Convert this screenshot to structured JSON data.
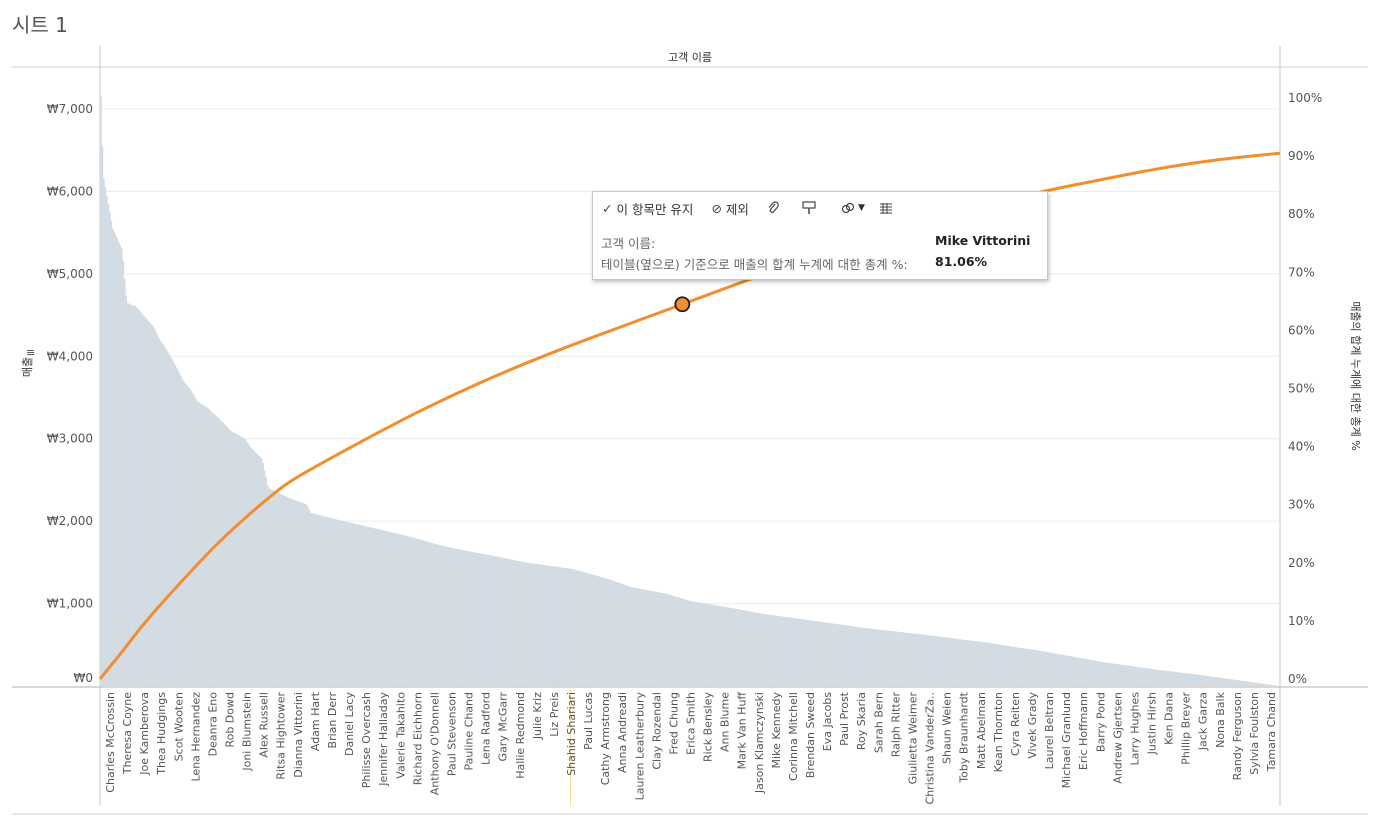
{
  "sheet": {
    "title": "시트 1"
  },
  "tooltip": {
    "keep_only": "이 항목만 유지",
    "exclude": "제외",
    "field1_label": "고객 이름:",
    "field1_value": "Mike Vittorini",
    "field2_label": "테이블(옆으로) 기준으로 매출의 합계 누계에 대한 총계 %:",
    "field2_value": "81.06%",
    "icons": [
      "check-icon",
      "exclude-icon",
      "paperclip-icon",
      "brush-icon",
      "group-icon",
      "chevron-down-icon",
      "table-view-icon"
    ]
  },
  "colors": {
    "bar": "#d3dbe3",
    "line": "#f28e2b",
    "highlight": "#f5e28a"
  },
  "chart_data": {
    "type": "bar",
    "title": "",
    "xlabel": "고객 이름",
    "ylabel": "매출",
    "y2label": "매출의 합계 누계에 대한 총계 %",
    "ylim": [
      0,
      7400
    ],
    "y2lim": [
      0,
      1.035
    ],
    "y_ticks": [
      "₩0",
      "₩1,000",
      "₩2,000",
      "₩3,000",
      "₩4,000",
      "₩5,000",
      "₩6,000",
      "₩7,000"
    ],
    "y_tick_values": [
      0,
      1000,
      2000,
      3000,
      4000,
      5000,
      6000,
      7000
    ],
    "y2_ticks": [
      "0%",
      "10%",
      "20%",
      "30%",
      "40%",
      "50%",
      "60%",
      "70%",
      "80%",
      "90%",
      "100%"
    ],
    "y2_tick_values": [
      0,
      0.1,
      0.2,
      0.3,
      0.4,
      0.5,
      0.6,
      0.7,
      0.8,
      0.9,
      1.0
    ],
    "categories": [
      "Charles McCrossin",
      "Theresa Coyne",
      "Joe Kamberova",
      "Thea Hudgings",
      "Scot Wooten",
      "Lena Hernandez",
      "Deanra Eno",
      "Rob Dowd",
      "Joni Blumstein",
      "Alex Russell",
      "Ritsa Hightower",
      "Dianna Vittorini",
      "Adam Hart",
      "Brian Derr",
      "Daniel Lacy",
      "Philisse Overcash",
      "Jennifer Halladay",
      "Valerie Takahito",
      "Richard Eichhorn",
      "Anthony O'Donnell",
      "Paul Stevenson",
      "Pauline Chand",
      "Lena Radford",
      "Gary McGarr",
      "Hallie Redmond",
      "Julie Kriz",
      "Liz Preis",
      "Shahid Shariari",
      "Paul Lucas",
      "Cathy Armstrong",
      "Anna Andreadi",
      "Lauren Leatherbury",
      "Clay Rozendal",
      "Fred Chung",
      "Erica Smith",
      "Rick Bensley",
      "Ann Blume",
      "Mark Van Huff",
      "Jason Klamczynski",
      "Mike Kennedy",
      "Corinna Mitchell",
      "Brendan Sweed",
      "Eva Jacobs",
      "Paul Prost",
      "Roy Skaria",
      "Sarah Bern",
      "Ralph Ritter",
      "Giulietta Weimer",
      "Christina VanderZa..",
      "Shaun Weien",
      "Toby Braunhardt",
      "Matt Abelman",
      "Kean Thornton",
      "Cyra Reiten",
      "Vivek Grady",
      "Laurel Beltran",
      "Michael Granlund",
      "Eric Hoffmann",
      "Barry Pond",
      "Andrew Gjertsen",
      "Larry Hughes",
      "Justin Hirsh",
      "Ken Dana",
      "Phillip Breyer",
      "Jack Garza",
      "Nona Balk",
      "Randy Ferguson",
      "Sylvia Foulston",
      "Tamara Chand"
    ],
    "highlighted_category": "Shahid Shariari",
    "sales_profile": [
      [
        0,
        7150
      ],
      [
        0.002,
        6200
      ],
      [
        0.005,
        5950
      ],
      [
        0.01,
        5550
      ],
      [
        0.018,
        5300
      ],
      [
        0.022,
        4650
      ],
      [
        0.03,
        4600
      ],
      [
        0.045,
        4350
      ],
      [
        0.05,
        4200
      ],
      [
        0.055,
        4100
      ],
      [
        0.063,
        3900
      ],
      [
        0.07,
        3700
      ],
      [
        0.076,
        3600
      ],
      [
        0.082,
        3450
      ],
      [
        0.09,
        3380
      ],
      [
        0.1,
        3250
      ],
      [
        0.11,
        3100
      ],
      [
        0.122,
        3000
      ],
      [
        0.128,
        2880
      ],
      [
        0.137,
        2750
      ],
      [
        0.142,
        2400
      ],
      [
        0.16,
        2280
      ],
      [
        0.175,
        2200
      ],
      [
        0.178,
        2100
      ],
      [
        0.2,
        2020
      ],
      [
        0.23,
        1920
      ],
      [
        0.26,
        1820
      ],
      [
        0.29,
        1700
      ],
      [
        0.31,
        1640
      ],
      [
        0.34,
        1560
      ],
      [
        0.36,
        1500
      ],
      [
        0.4,
        1420
      ],
      [
        0.43,
        1300
      ],
      [
        0.45,
        1200
      ],
      [
        0.48,
        1120
      ],
      [
        0.5,
        1030
      ],
      [
        0.53,
        960
      ],
      [
        0.56,
        880
      ],
      [
        0.6,
        800
      ],
      [
        0.65,
        700
      ],
      [
        0.7,
        620
      ],
      [
        0.75,
        530
      ],
      [
        0.8,
        420
      ],
      [
        0.85,
        290
      ],
      [
        0.9,
        190
      ],
      [
        0.93,
        140
      ],
      [
        0.96,
        80
      ],
      [
        0.98,
        40
      ],
      [
        1.0,
        0
      ]
    ],
    "pareto_curve": [
      [
        0,
        0
      ],
      [
        0.01,
        0.025
      ],
      [
        0.02,
        0.05
      ],
      [
        0.035,
        0.09
      ],
      [
        0.05,
        0.125
      ],
      [
        0.07,
        0.17
      ],
      [
        0.1,
        0.235
      ],
      [
        0.13,
        0.29
      ],
      [
        0.142,
        0.31
      ],
      [
        0.16,
        0.34
      ],
      [
        0.2,
        0.385
      ],
      [
        0.25,
        0.44
      ],
      [
        0.3,
        0.49
      ],
      [
        0.35,
        0.535
      ],
      [
        0.4,
        0.575
      ],
      [
        0.44,
        0.605
      ],
      [
        0.48,
        0.635
      ],
      [
        0.4935,
        0.645
      ],
      [
        0.52,
        0.665
      ],
      [
        0.56,
        0.695
      ],
      [
        0.6,
        0.72
      ],
      [
        0.65,
        0.755
      ],
      [
        0.7,
        0.785
      ],
      [
        0.75,
        0.815
      ],
      [
        0.8,
        0.84
      ],
      [
        0.85,
        0.86
      ],
      [
        0.9,
        0.88
      ],
      [
        0.95,
        0.895
      ],
      [
        1.0,
        0.905
      ]
    ],
    "selected_point": {
      "category": "Mike Vittorini",
      "value": 0.8106
    },
    "grid": true
  }
}
